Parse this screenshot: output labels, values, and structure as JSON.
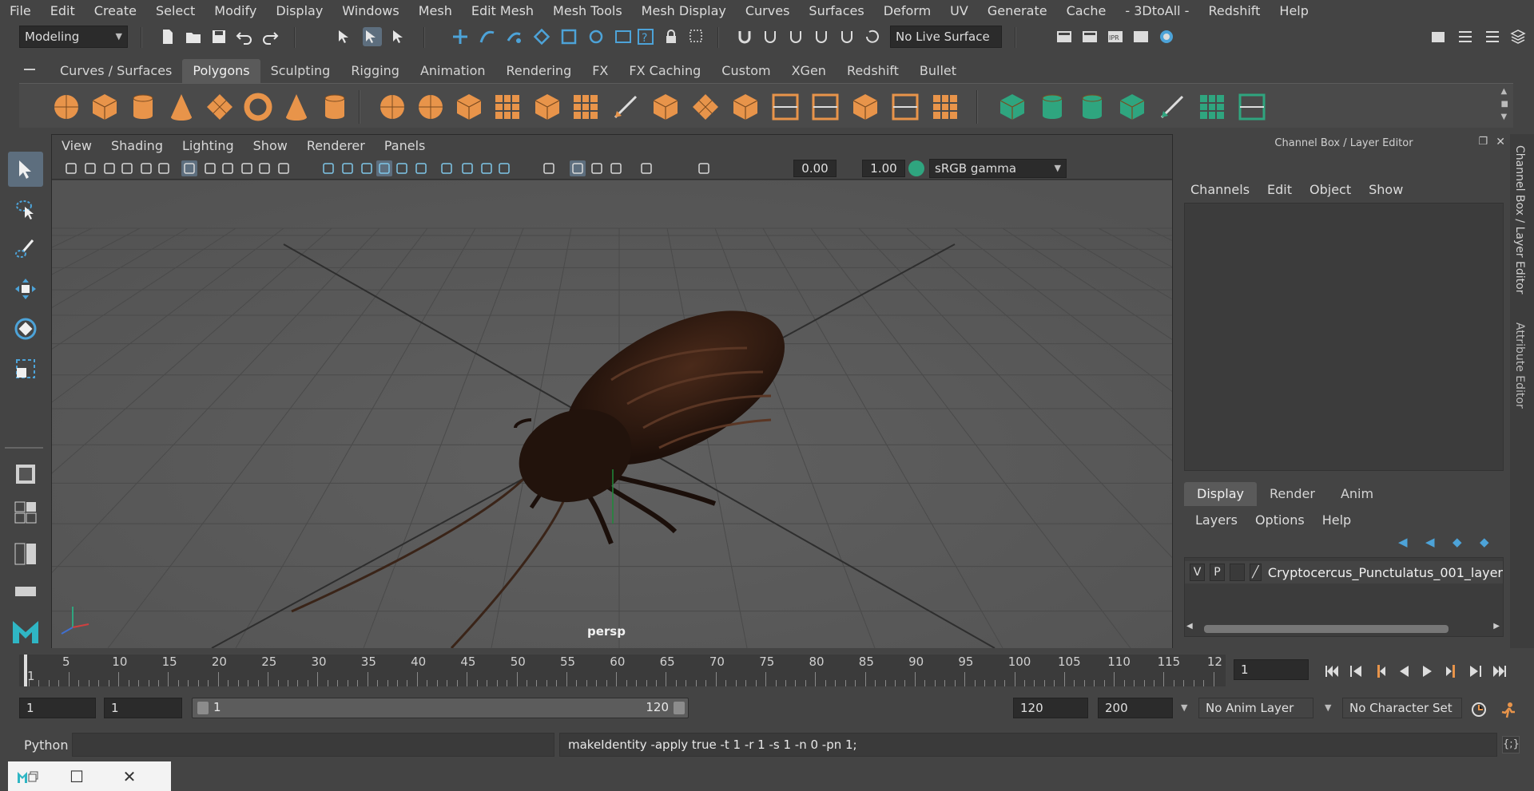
{
  "menubar": [
    "File",
    "Edit",
    "Create",
    "Select",
    "Modify",
    "Display",
    "Windows",
    "Mesh",
    "Edit Mesh",
    "Mesh Tools",
    "Mesh Display",
    "Curves",
    "Surfaces",
    "Deform",
    "UV",
    "Generate",
    "Cache",
    "- 3DtoAll -",
    "Redshift",
    "Help"
  ],
  "statusline": {
    "mode": "Modeling",
    "live_surface": "No Live Surface"
  },
  "shelf_tabs": [
    {
      "label": "Curves / Surfaces"
    },
    {
      "label": "Polygons",
      "active": true
    },
    {
      "label": "Sculpting"
    },
    {
      "label": "Rigging"
    },
    {
      "label": "Animation"
    },
    {
      "label": "Rendering"
    },
    {
      "label": "FX"
    },
    {
      "label": "FX Caching"
    },
    {
      "label": "Custom"
    },
    {
      "label": "XGen"
    },
    {
      "label": "Redshift"
    },
    {
      "label": "Bullet"
    }
  ],
  "colors": {
    "shelf_orange": "#e8944a",
    "shelf_teal": "#2fa57f",
    "shelf_blue": "#4da3d8",
    "accent_active": "#5d6e7e",
    "viewport_bg": "#5c5c5c",
    "grid_line": "#4a4a4a",
    "insect_body": "#3a1f14"
  },
  "viewport": {
    "menu": [
      "View",
      "Shading",
      "Lighting",
      "Show",
      "Renderer",
      "Panels"
    ],
    "exposure": "0.00",
    "gamma": "1.00",
    "color_space": "sRGB gamma",
    "camera_label": "persp"
  },
  "right_panel": {
    "title": "Channel Box / Layer Editor",
    "menu": [
      "Channels",
      "Edit",
      "Object",
      "Show"
    ],
    "tabs": [
      "Display",
      "Render",
      "Anim"
    ],
    "active_tab": "Display",
    "layer_menu": [
      "Layers",
      "Options",
      "Help"
    ],
    "layer": {
      "v": "V",
      "p": "P",
      "name": "Cryptocercus_Punctulatus_001_layer"
    },
    "side_tabs": [
      "Channel Box / Layer Editor",
      "Attribute Editor"
    ]
  },
  "timeline": {
    "start_label": "1",
    "ticks": [
      "5",
      "10",
      "15",
      "20",
      "25",
      "30",
      "35",
      "40",
      "45",
      "50",
      "55",
      "60",
      "65",
      "70",
      "75",
      "80",
      "85",
      "90",
      "95",
      "100",
      "105",
      "110",
      "115",
      "12"
    ],
    "current_frame": "1"
  },
  "range": {
    "start": "1",
    "playback_start": "1",
    "slider_start": "1",
    "slider_end": "120",
    "playback_end": "120",
    "end": "200",
    "anim_layer": "No Anim Layer",
    "character_set": "No Character Set"
  },
  "command": {
    "language": "Python",
    "result": "makeIdentity -apply true -t 1 -r 1 -s 1 -n 0 -pn 1;"
  }
}
